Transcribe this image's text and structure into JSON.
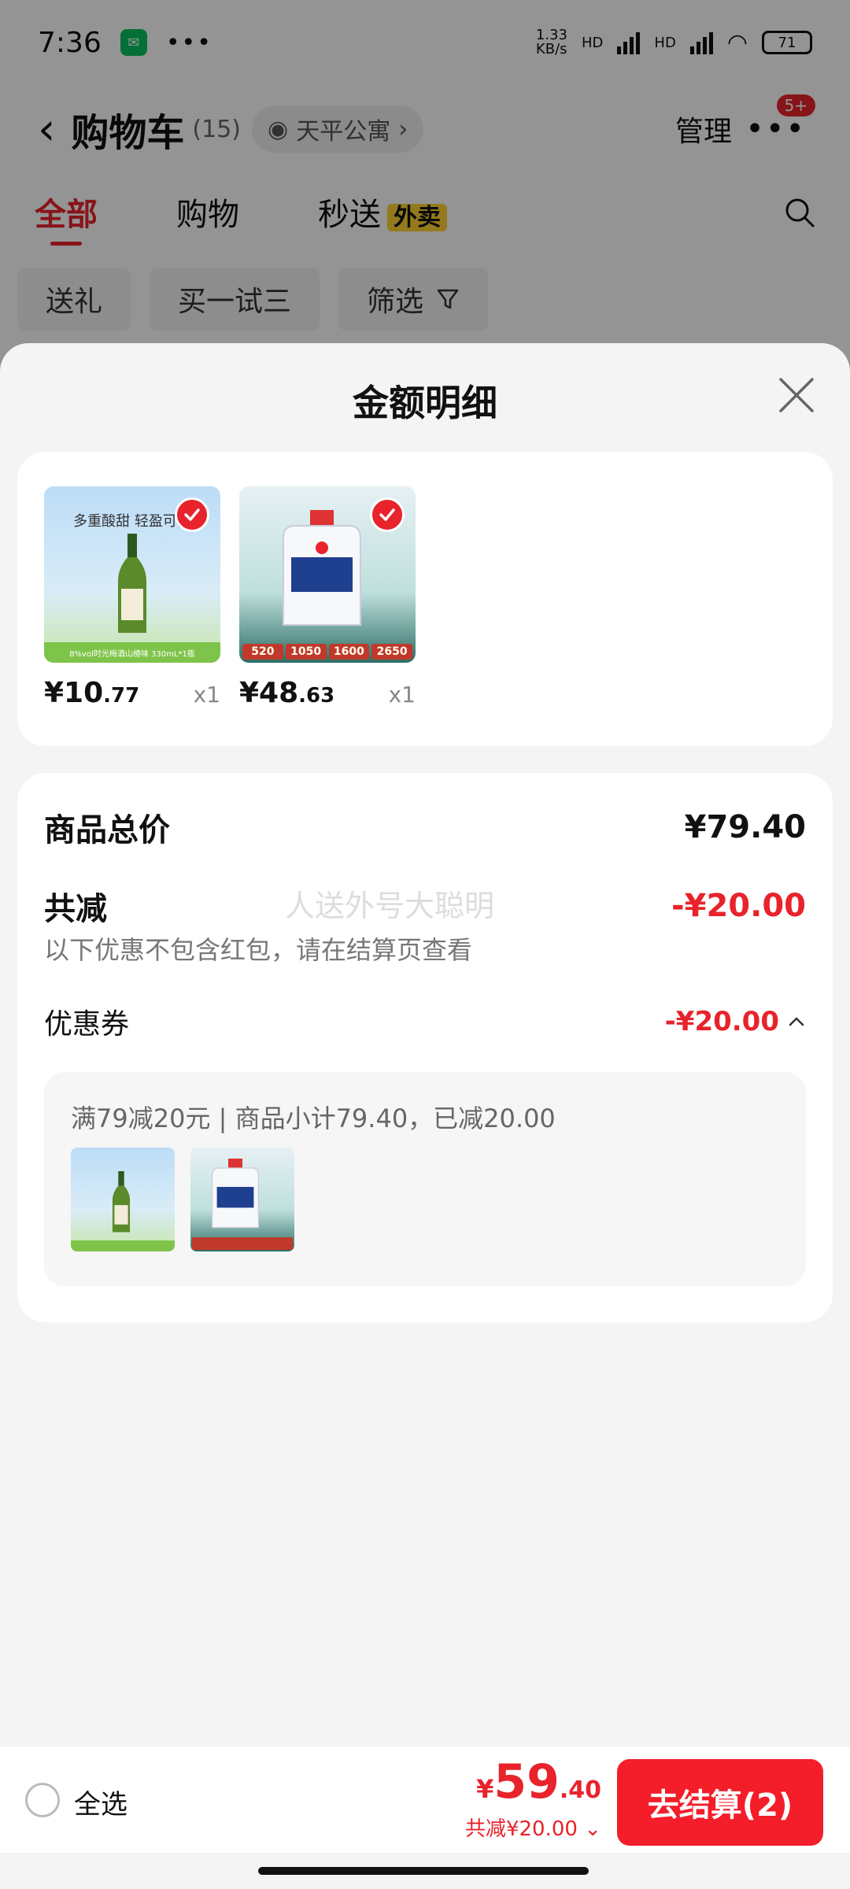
{
  "status": {
    "time": "7:36",
    "net_speed": "1.33\nKB/s",
    "hd1": "HD",
    "hd2": "HD",
    "battery": "71"
  },
  "header": {
    "title": "购物车",
    "count": "(15)",
    "address": "天平公寓",
    "manage": "管理",
    "badge": "5+"
  },
  "tabs": [
    {
      "label": "全部"
    },
    {
      "label": "购物"
    },
    {
      "label": "秒送"
    }
  ],
  "tab_badge": "外卖",
  "chips": [
    {
      "label": "送礼"
    },
    {
      "label": "买一试三"
    },
    {
      "label": "筛选"
    }
  ],
  "sheet": {
    "title": "金额明细",
    "goods": [
      {
        "price_int": "¥10",
        "price_dec": ".77",
        "qty": "x1"
      },
      {
        "price_int": "¥48",
        "price_dec": ".63",
        "qty": "x1"
      }
    ],
    "total_label": "商品总价",
    "total_value": "¥79.40",
    "discount_label": "共减",
    "discount_value": "-¥20.00",
    "note": "以下优惠不包含红包，请在结算页查看",
    "watermark": "人送外号大聪明",
    "coupon_label": "优惠券",
    "coupon_value": "-¥20.00",
    "coupon_desc": "满79减20元 | 商品小计79.40，已减20.00"
  },
  "bottom": {
    "select_all": "全选",
    "yen": "¥",
    "total_int": "59",
    "total_dec": ".40",
    "saving": "共减¥20.00",
    "checkout": "去结算(2)"
  },
  "images": {
    "item1_tagline": "多重酸甜 轻盈可口",
    "item1_band": "8%vol时光梅酒山楂味 330mL*1瓶",
    "item2_prices": [
      "520",
      "1050",
      "1600",
      "2650"
    ]
  },
  "colors": {
    "accent": "#e8232b",
    "checkout_bg": "#f41d2a"
  }
}
